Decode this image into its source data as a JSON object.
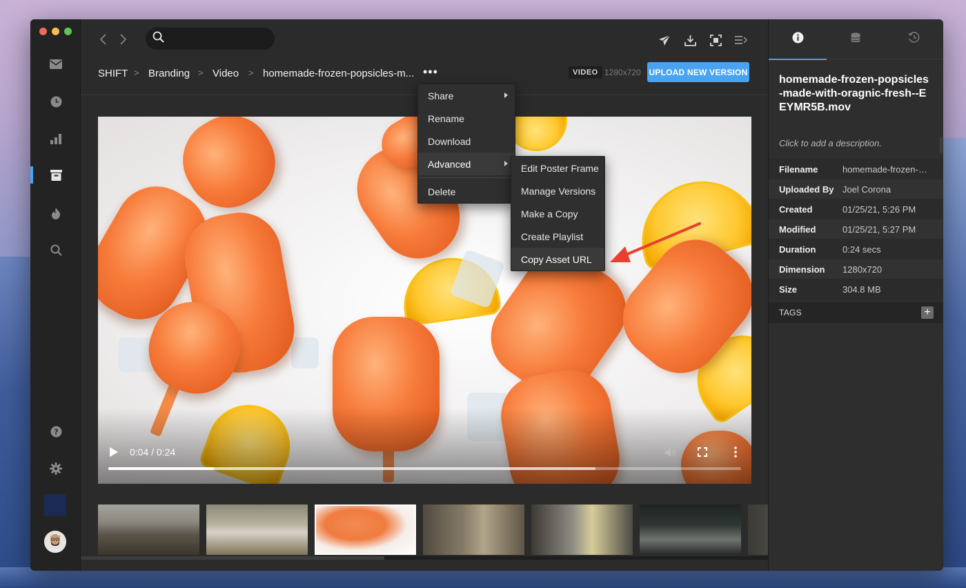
{
  "window": {
    "traffic_colors": [
      "#ec6b5f",
      "#f4bf4f",
      "#61c554"
    ]
  },
  "rail": {
    "items": [
      {
        "name": "inbox-icon",
        "active": false
      },
      {
        "name": "recent-icon",
        "active": false
      },
      {
        "name": "analytics-icon",
        "active": false
      },
      {
        "name": "projects-icon",
        "active": true
      },
      {
        "name": "trending-icon",
        "active": false
      },
      {
        "name": "search-icon",
        "active": false
      }
    ],
    "bottom": [
      "help-icon",
      "gear-icon"
    ]
  },
  "search": {
    "placeholder": "",
    "value": ""
  },
  "breadcrumb": {
    "items": [
      "SHIFT",
      "Branding",
      "Video",
      "homemade-frozen-popsicles-m..."
    ],
    "more": "•••"
  },
  "asset_header": {
    "type_badge": "VIDEO",
    "dimensions": "1280x720",
    "upload_label": "UPLOAD NEW VERSION"
  },
  "context_menu": {
    "items": [
      {
        "label": "Share",
        "submenu": true
      },
      {
        "label": "Rename",
        "submenu": false
      },
      {
        "label": "Download",
        "submenu": false
      },
      {
        "label": "Advanced",
        "submenu": true,
        "active": true
      },
      {
        "label": "Delete",
        "submenu": false
      }
    ],
    "advanced_submenu": [
      "Edit Poster Frame",
      "Manage Versions",
      "Make a Copy",
      "Create Playlist",
      "Copy Asset URL"
    ],
    "highlighted_submenu_item": "Copy Asset URL"
  },
  "player": {
    "time_label": "0:04 / 0:24",
    "current_seconds": 4,
    "duration_seconds": 24,
    "buffered_fraction": 0.77
  },
  "thumbnails": {
    "count": 7,
    "selected_index": 2
  },
  "panel": {
    "tabs": [
      "info-icon",
      "storage-icon",
      "history-icon"
    ],
    "title": "homemade-frozen-popsicles-made-with-oragnic-fresh--EEYMR5B.mov",
    "description_placeholder": "Click to add a description.",
    "meta": [
      {
        "key": "Filename",
        "value": "homemade-frozen-popsicles-made-with-oragnic-fresh--EEYMR5B.mov"
      },
      {
        "key": "Uploaded By",
        "value": "Joel Corona"
      },
      {
        "key": "Created",
        "value": "01/25/21, 5:26 PM"
      },
      {
        "key": "Modified",
        "value": "01/25/21, 5:27 PM"
      },
      {
        "key": "Duration",
        "value": "0:24 secs"
      },
      {
        "key": "Dimension",
        "value": "1280x720"
      },
      {
        "key": "Size",
        "value": "304.8 MB"
      }
    ],
    "tags_label": "TAGS",
    "tags_add": "+"
  },
  "colors": {
    "accent": "#4aa3f0",
    "annotation_arrow": "#e8402f"
  }
}
